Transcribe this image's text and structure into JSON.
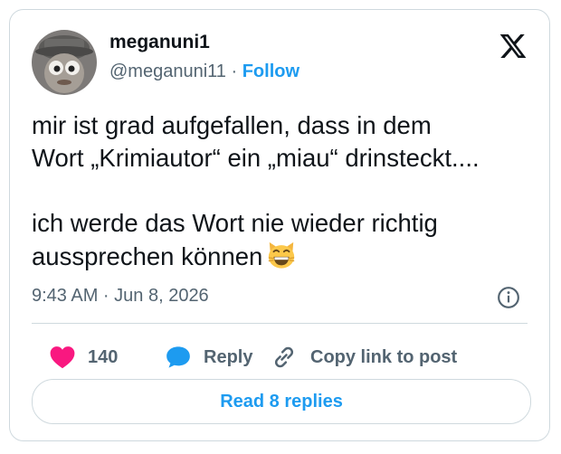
{
  "author": {
    "display_name": "meganuni1",
    "handle": "@meganuni11",
    "separator": "·",
    "follow_label": "Follow"
  },
  "tweet": {
    "paragraphs": [
      "mir ist grad aufgefallen, dass in dem\nWort „Krimiautor“ ein „miau“ drinsteckt....",
      "ich werde das Wort nie wieder richtig\naussprechen können"
    ],
    "emoji": "grinning-cat-with-smiling-eyes",
    "timestamp": "9:43 AM · Jun 8, 2026"
  },
  "actions": {
    "like_count": "140",
    "reply_label": "Reply",
    "copy_link_label": "Copy link to post",
    "read_replies_label": "Read 8 replies"
  },
  "icons": {
    "logo": "x-logo-icon",
    "info": "info-icon",
    "like": "heart-icon",
    "reply": "speech-bubble-icon",
    "copy": "link-icon"
  },
  "colors": {
    "accent": "#1d9bf0",
    "like": "#f91880",
    "secondary_text": "#536471",
    "border": "#cfd9de"
  }
}
